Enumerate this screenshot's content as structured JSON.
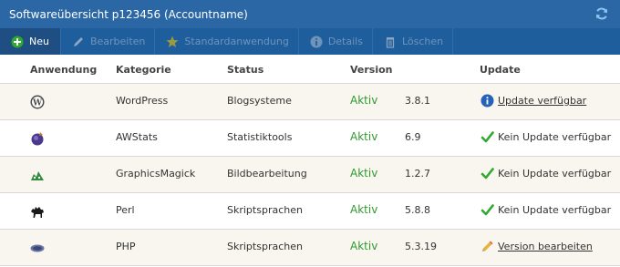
{
  "window": {
    "title": "Softwareübersicht p123456 (Accountname)"
  },
  "toolbar": {
    "new_label": "Neu",
    "edit_label": "Bearbeiten",
    "default_label": "Standardanwendung",
    "details_label": "Details",
    "delete_label": "Löschen"
  },
  "table": {
    "headers": {
      "app": "Anwendung",
      "category": "Kategorie",
      "status": "Status",
      "version": "Version",
      "update": "Update"
    },
    "rows": [
      {
        "name": "WordPress",
        "category": "Blogsysteme",
        "status": "Aktiv",
        "version": "3.8.1",
        "update": "Update verfügbar",
        "update_type": "info",
        "icon": "wordpress-icon"
      },
      {
        "name": "AWStats",
        "category": "Statistiktools",
        "status": "Aktiv",
        "version": "6.9",
        "update": "Kein Update verfügbar",
        "update_type": "ok",
        "icon": "awstats-icon"
      },
      {
        "name": "GraphicsMagick",
        "category": "Bildbearbeitung",
        "status": "Aktiv",
        "version": "1.2.7",
        "update": "Kein Update verfügbar",
        "update_type": "ok",
        "icon": "graphicsmagick-icon"
      },
      {
        "name": "Perl",
        "category": "Skriptsprachen",
        "status": "Aktiv",
        "version": "5.8.8",
        "update": "Kein Update verfügbar",
        "update_type": "ok",
        "icon": "perl-camel-icon"
      },
      {
        "name": "PHP",
        "category": "Skriptsprachen",
        "status": "Aktiv",
        "version": "5.3.19",
        "update": "Version bearbeiten",
        "update_type": "edit",
        "icon": "php-icon"
      }
    ]
  },
  "colors": {
    "titlebar": "#2a67a4",
    "toolbar": "#1f5e9c",
    "status_active": "#2f9a2f",
    "row_alt": "#f8f6ee"
  }
}
